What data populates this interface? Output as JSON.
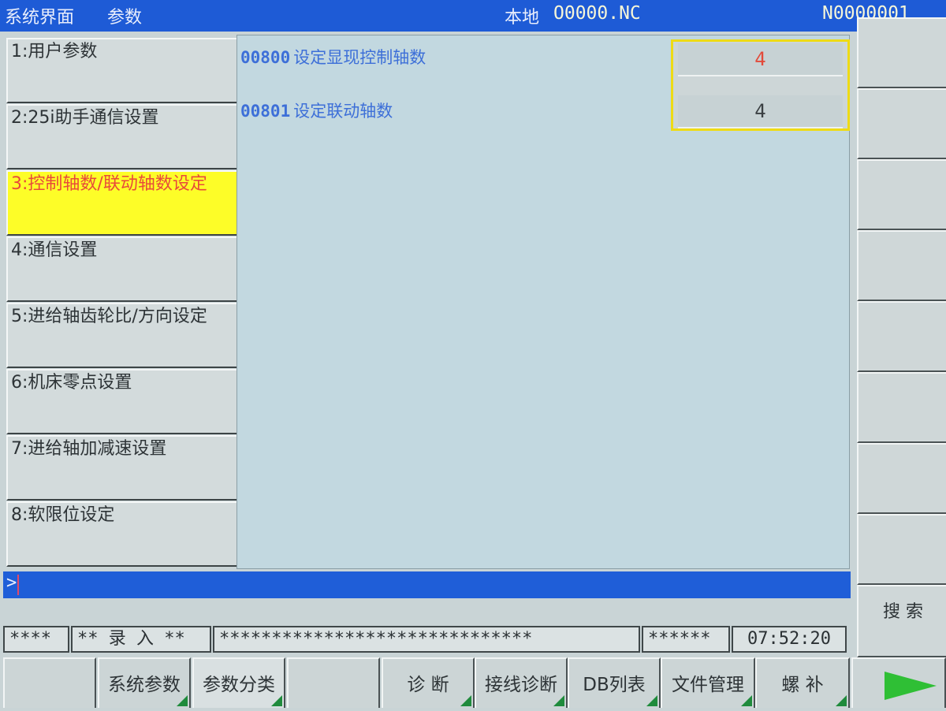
{
  "header": {
    "screen_name": "系统界面",
    "section": "参数",
    "location": "本地",
    "program": "O0000.NC",
    "sequence_number": "N0000001"
  },
  "menu": {
    "items": [
      {
        "label": "1:用户参数",
        "active": false
      },
      {
        "label": "2:25i助手通信设置",
        "active": false
      },
      {
        "label": "3:控制轴数/联动轴数设定",
        "active": true
      },
      {
        "label": "4:通信设置",
        "active": false
      },
      {
        "label": "5:进给轴齿轮比/方向设定",
        "active": false
      },
      {
        "label": "6:机床零点设置",
        "active": false
      },
      {
        "label": "7:进给轴加减速设置",
        "active": false
      },
      {
        "label": "8:软限位设定",
        "active": false
      }
    ]
  },
  "params": [
    {
      "number": "00800",
      "label": "设定显现控制轴数",
      "value": "4",
      "value_color": "#e24a3a"
    },
    {
      "number": "00801",
      "label": "设定联动轴数",
      "value": "4",
      "value_color": "#3a3f42"
    }
  ],
  "input": {
    "prompt": ">",
    "value": ""
  },
  "status": {
    "field1": "****",
    "mode": "** 录 入 **",
    "field3": "******************************",
    "field4": "******",
    "time": "07:52:20"
  },
  "side_keys": {
    "search": "搜 索"
  },
  "softkeys": [
    {
      "label": "",
      "has_marker": false
    },
    {
      "label": "系统参数",
      "has_marker": true
    },
    {
      "label": "参数分类",
      "has_marker": true
    },
    {
      "label": "",
      "has_marker": false
    },
    {
      "label": "诊 断",
      "has_marker": true
    },
    {
      "label": "接线诊断",
      "has_marker": true
    },
    {
      "label": "DB列表",
      "has_marker": true
    },
    {
      "label": "文件管理",
      "has_marker": true
    },
    {
      "label": "螺 补",
      "has_marker": true
    }
  ],
  "icons": {
    "next_page": "next-page-arrow-icon"
  },
  "colors": {
    "title_bar": "#1e5bd6",
    "active_item": "#fdfd28",
    "param_text": "#3d6fd8",
    "highlight_border": "#eedb15",
    "softkey_marker": "#1f8b3c"
  }
}
